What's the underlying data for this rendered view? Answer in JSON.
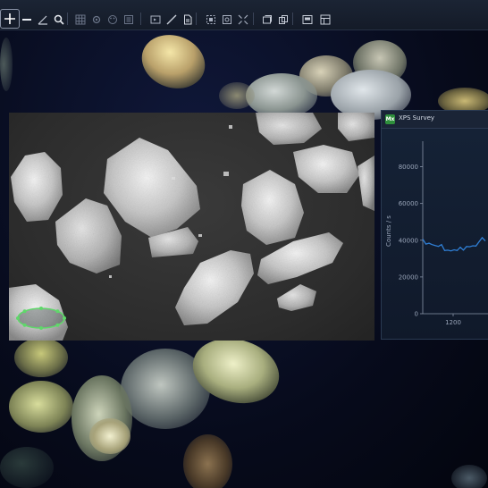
{
  "toolbar": {
    "tools": [
      {
        "id": "pan",
        "icon": "crosshair-move-icon",
        "active": true
      },
      {
        "id": "line",
        "icon": "minus-icon"
      },
      {
        "id": "angle",
        "icon": "angle-icon"
      },
      {
        "id": "zoom",
        "icon": "magnifier-icon"
      },
      {
        "id": "grid-a",
        "icon": "grid-icon"
      },
      {
        "id": "settings",
        "icon": "gear-icon"
      },
      {
        "id": "palette",
        "icon": "palette-icon"
      },
      {
        "id": "layers",
        "icon": "layers-icon"
      },
      {
        "id": "frame",
        "icon": "frame-icon"
      },
      {
        "id": "draw",
        "icon": "pencil-line-icon"
      },
      {
        "id": "doc",
        "icon": "document-icon"
      },
      {
        "id": "select",
        "icon": "selection-icon"
      },
      {
        "id": "capture",
        "icon": "camera-icon"
      },
      {
        "id": "expand",
        "icon": "expand-icon"
      },
      {
        "id": "stack",
        "icon": "stack-icon"
      },
      {
        "id": "copy",
        "icon": "copy-icon"
      },
      {
        "id": "export",
        "icon": "export-icon"
      },
      {
        "id": "table",
        "icon": "table-icon"
      }
    ]
  },
  "sem_image": {
    "annotation": {
      "shape": "ellipse",
      "color": "#5fd86a"
    }
  },
  "xps_window": {
    "icon_text": "Mx",
    "title": "XPS Survey",
    "accent": "#2f8f3c"
  },
  "chart_data": {
    "type": "line",
    "title": "",
    "xlabel": "",
    "ylabel": "Counts / s",
    "y_ticks": [
      0,
      20000,
      40000,
      60000,
      80000
    ],
    "x_ticks": [
      1200
    ],
    "ylim": [
      0,
      90000
    ],
    "xlim": [
      1100,
      1300
    ],
    "series": [
      {
        "color": "#2f7fd6",
        "x": [
          1100,
          1110,
          1120,
          1130,
          1140,
          1150,
          1160,
          1170,
          1180,
          1190,
          1200,
          1210,
          1220,
          1230,
          1240,
          1250,
          1260,
          1270,
          1280,
          1290,
          1300
        ],
        "y": [
          40000,
          38500,
          37800,
          38200,
          36500,
          37200,
          37000,
          35000,
          34000,
          34800,
          34200,
          35000,
          35600,
          35200,
          36000,
          37000,
          36400,
          37400,
          38600,
          42000,
          39000
        ]
      }
    ]
  }
}
